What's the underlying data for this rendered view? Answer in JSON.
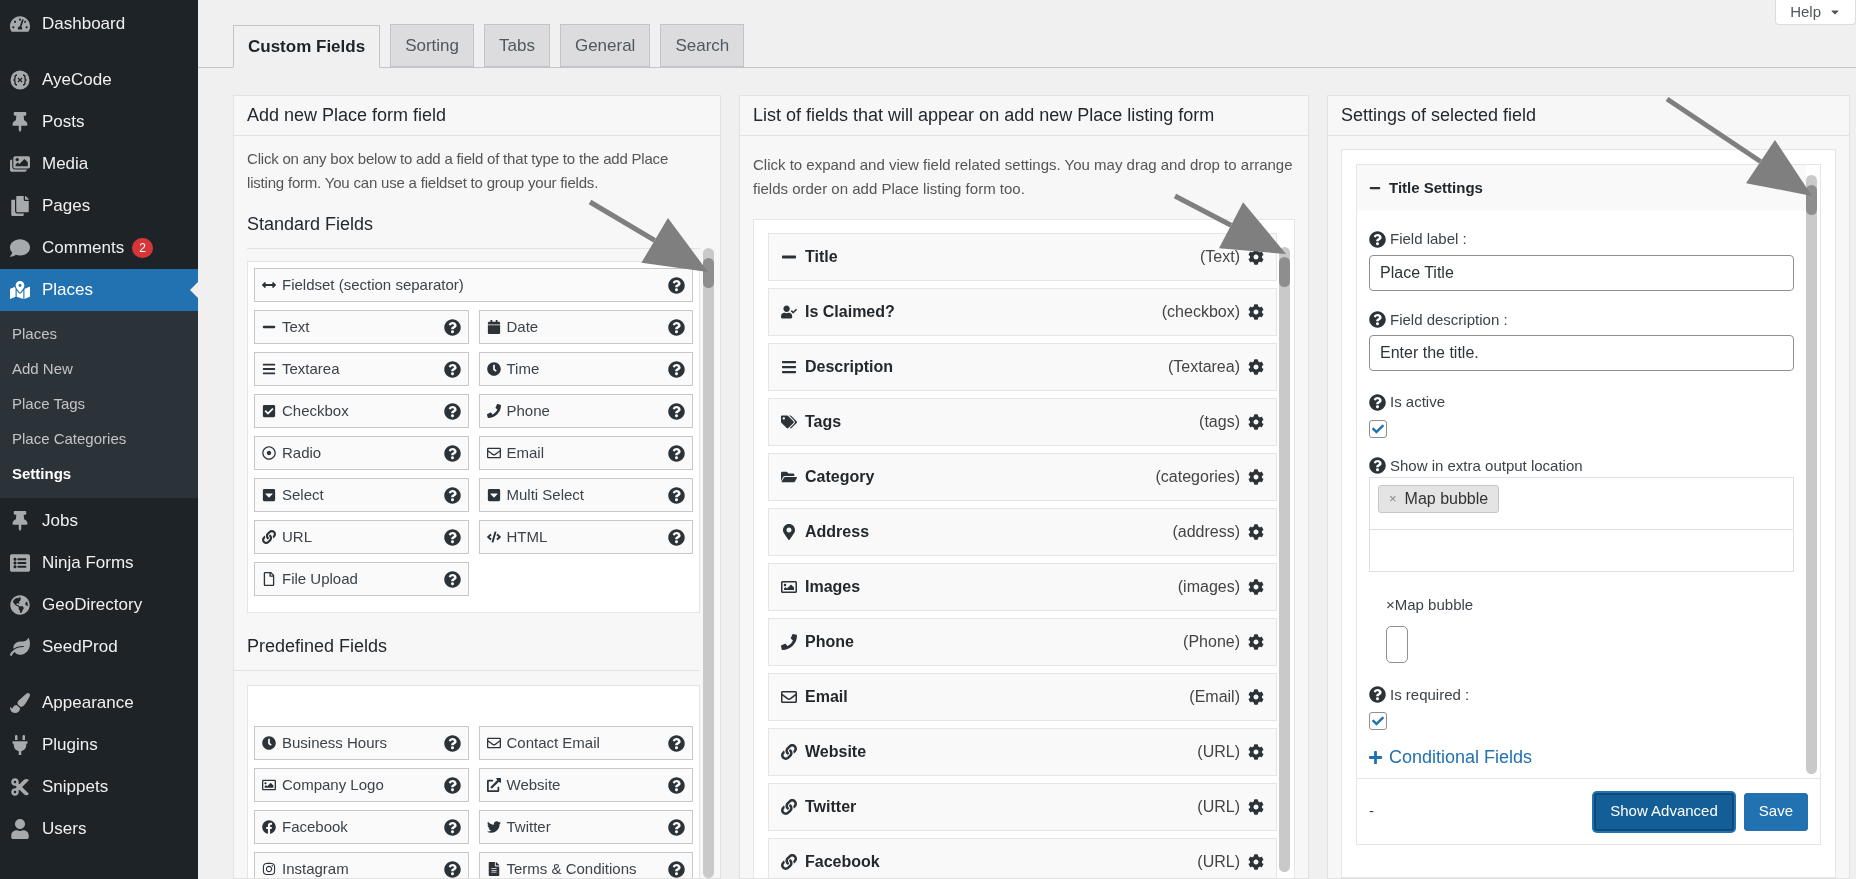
{
  "sidebar": {
    "sections": [
      {
        "items": [
          {
            "label": "Dashboard",
            "selected": false
          }
        ]
      },
      {
        "items": [
          {
            "label": "AyeCode",
            "selected": false
          },
          {
            "label": "Posts",
            "selected": false
          },
          {
            "label": "Media",
            "selected": false
          },
          {
            "label": "Pages",
            "selected": false
          },
          {
            "label": "Comments",
            "selected": false,
            "badge": "2"
          },
          {
            "label": "Places",
            "selected": true,
            "children": [
              {
                "label": "Places",
                "selected": false
              },
              {
                "label": "Add New",
                "selected": false
              },
              {
                "label": "Place Tags",
                "selected": false
              },
              {
                "label": "Place Categories",
                "selected": false
              },
              {
                "label": "Settings",
                "selected": true
              }
            ]
          },
          {
            "label": "Jobs",
            "selected": false
          },
          {
            "label": "Ninja Forms",
            "selected": false
          },
          {
            "label": "GeoDirectory",
            "selected": false
          },
          {
            "label": "SeedProd",
            "selected": false
          }
        ]
      },
      {
        "items": [
          {
            "label": "Appearance",
            "selected": false
          },
          {
            "label": "Plugins",
            "selected": false
          },
          {
            "label": "Snippets",
            "selected": false
          },
          {
            "label": "Users",
            "selected": false
          }
        ]
      }
    ]
  },
  "help_button": "Help",
  "tabs": [
    {
      "label": "Custom Fields",
      "selected": true
    },
    {
      "label": "Sorting",
      "selected": false
    },
    {
      "label": "Tabs",
      "selected": false
    },
    {
      "label": "General",
      "selected": false
    },
    {
      "label": "Search",
      "selected": false
    }
  ],
  "add_panel": {
    "title": "Add new Place form field",
    "description": "Click on any box below to add a field of that type to the add Place listing form. You can use a fieldset to group your fields.",
    "groups": [
      {
        "title": "Standard Fields",
        "fields": [
          {
            "label": "Fieldset (section separator)",
            "kind": "wide"
          },
          {
            "label": "Text",
            "kind": "normal"
          },
          {
            "label": "Date",
            "kind": "normal"
          },
          {
            "label": "Textarea",
            "kind": "normal"
          },
          {
            "label": "Time",
            "kind": "normal"
          },
          {
            "label": "Checkbox",
            "kind": "normal"
          },
          {
            "label": "Phone",
            "kind": "normal"
          },
          {
            "label": "Radio",
            "kind": "normal"
          },
          {
            "label": "Email",
            "kind": "normal"
          },
          {
            "label": "Select",
            "kind": "normal"
          },
          {
            "label": "Multi Select",
            "kind": "normal"
          },
          {
            "label": "URL",
            "kind": "normal"
          },
          {
            "label": "HTML",
            "kind": "normal"
          },
          {
            "label": "File Upload",
            "kind": "normal"
          }
        ]
      },
      {
        "title": "Predefined Fields",
        "fields": [
          {
            "label": "Business Hours",
            "kind": "normal"
          },
          {
            "label": "Contact Email",
            "kind": "normal"
          },
          {
            "label": "Company Logo",
            "kind": "normal"
          },
          {
            "label": "Website",
            "kind": "normal"
          },
          {
            "label": "Facebook",
            "kind": "normal"
          },
          {
            "label": "Twitter",
            "kind": "normal"
          },
          {
            "label": "Instagram",
            "kind": "normal"
          },
          {
            "label": "Terms & Conditions",
            "kind": "normal"
          }
        ]
      }
    ]
  },
  "list_panel": {
    "title": "List of fields that will appear on add new Place listing form",
    "description": "Click to expand and view field related settings. You may drag and drop to arrange fields order on add Place listing form too.",
    "fields": [
      {
        "label": "Title",
        "type": "(Text)"
      },
      {
        "label": "Is Claimed?",
        "type": "(checkbox)"
      },
      {
        "label": "Description",
        "type": "(Textarea)"
      },
      {
        "label": "Tags",
        "type": "(tags)"
      },
      {
        "label": "Category",
        "type": "(categories)"
      },
      {
        "label": "Address",
        "type": "(address)"
      },
      {
        "label": "Images",
        "type": "(images)"
      },
      {
        "label": "Phone",
        "type": "(Phone)"
      },
      {
        "label": "Email",
        "type": "(Email)"
      },
      {
        "label": "Website",
        "type": "(URL)"
      },
      {
        "label": "Twitter",
        "type": "(URL)"
      },
      {
        "label": "Facebook",
        "type": "(URL)"
      }
    ]
  },
  "settings_panel": {
    "title": "Settings of selected field",
    "section_title": "Title Settings",
    "field_label": {
      "label": "Field label :",
      "value": "Place Title"
    },
    "field_description": {
      "label": "Field description :",
      "value": "Enter the title."
    },
    "is_active": {
      "label": "Is active",
      "checked": true
    },
    "output_location": {
      "label": "Show in extra output location",
      "tags": [
        {
          "label": "Map bubble",
          "remove": "×"
        }
      ]
    },
    "stray_option": "×Map bubble",
    "is_required": {
      "label": "Is required :",
      "checked": true
    },
    "conditional_link": "Conditional Fields",
    "footer_text": "-",
    "buttons": [
      {
        "label": "Show Advanced",
        "focused": true
      },
      {
        "label": "Save",
        "focused": false
      }
    ]
  }
}
